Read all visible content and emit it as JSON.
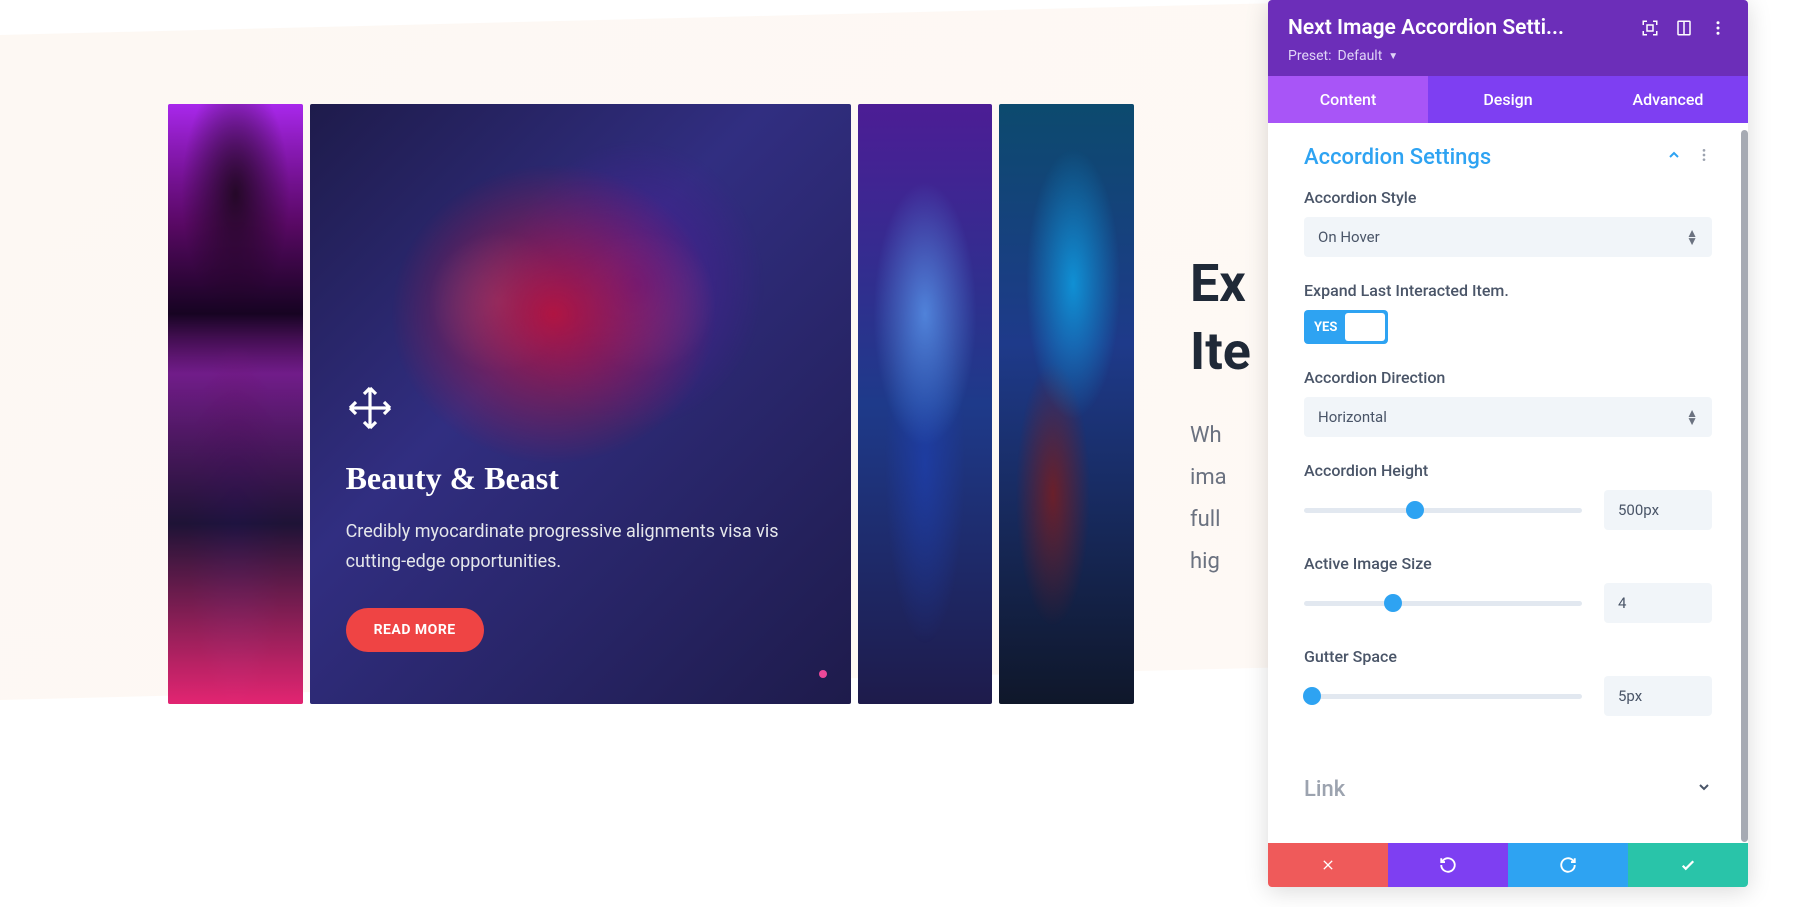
{
  "accordion_overlay": {
    "title": "Beauty & Beast",
    "description": "Credibly myocardinate progressive alignments visa vis cutting-edge opportunities.",
    "button_label": "READ MORE",
    "icon": "move-arrows-icon"
  },
  "side_heading_line1": "Ex",
  "side_heading_line2": "Ite",
  "side_paragraph_lines": [
    "Wh",
    "ima",
    "full",
    "hig"
  ],
  "panel": {
    "title": "Next Image Accordion Setti...",
    "preset_label": "Preset:",
    "preset_value": "Default",
    "tabs": [
      {
        "label": "Content",
        "active": true
      },
      {
        "label": "Design",
        "active": false
      },
      {
        "label": "Advanced",
        "active": false
      }
    ],
    "sections": {
      "accordion_settings": {
        "title": "Accordion Settings",
        "expanded": true,
        "fields": {
          "style": {
            "label": "Accordion Style",
            "value": "On Hover"
          },
          "expand_last": {
            "label": "Expand Last Interacted Item.",
            "toggle_text": "YES",
            "state": true
          },
          "direction": {
            "label": "Accordion Direction",
            "value": "Horizontal"
          },
          "height": {
            "label": "Accordion Height",
            "value": "500px",
            "slider_pct": 40
          },
          "active_size": {
            "label": "Active Image Size",
            "value": "4",
            "slider_pct": 32
          },
          "gutter": {
            "label": "Gutter Space",
            "value": "5px",
            "slider_pct": 3
          }
        }
      },
      "link": {
        "title": "Link",
        "expanded": false
      }
    },
    "footer_icons": {
      "cancel": "close-icon",
      "undo": "undo-icon",
      "redo": "redo-icon",
      "save": "check-icon"
    }
  }
}
